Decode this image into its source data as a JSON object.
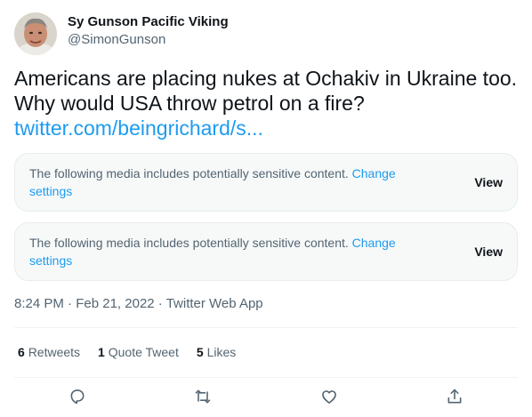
{
  "author": {
    "display_name": "Sy Gunson Pacific Viking",
    "handle": "@SimonGunson"
  },
  "tweet": {
    "line1": "Americans are placing nukes at Ochakiv in Ukraine too.",
    "line2": "Why would USA throw petrol on a fire?",
    "link": "twitter.com/beingrichard/s..."
  },
  "sensitive_notices": [
    {
      "text": "The following media includes potentially sensitive content. ",
      "change_link": "Change settings",
      "view_label": "View"
    },
    {
      "text": "The following media includes potentially sensitive content. ",
      "change_link": "Change settings",
      "view_label": "View"
    }
  ],
  "meta": {
    "time": "8:24 PM",
    "date": "Feb 21, 2022",
    "source": "Twitter Web App",
    "separator": "·"
  },
  "stats": {
    "retweets_count": "6",
    "retweets_label": "Retweets",
    "quotes_count": "1",
    "quotes_label": "Quote Tweet",
    "likes_count": "5",
    "likes_label": "Likes"
  },
  "actions": {
    "reply_icon": "reply-icon",
    "retweet_icon": "retweet-icon",
    "like_icon": "like-icon",
    "share_icon": "share-icon"
  },
  "colors": {
    "link": "#1d9bf0",
    "text_primary": "#0f1419",
    "text_secondary": "#536471",
    "notice_bg": "#f7f9f9"
  }
}
